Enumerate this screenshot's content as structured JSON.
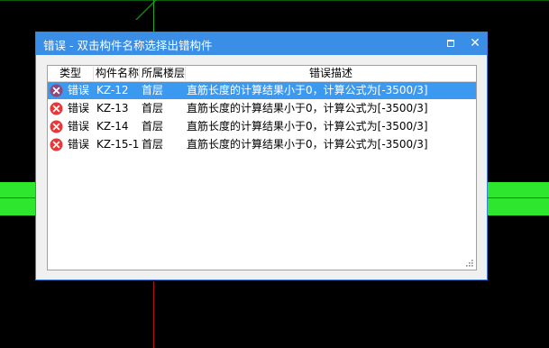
{
  "dialog": {
    "title": "错误 - 双击构件名称选择出错构件",
    "maximize_icon": "maximize-icon",
    "close_icon": "close-icon",
    "close_glyph": "✕"
  },
  "list": {
    "columns": [
      "类型",
      "构件名称",
      "所属楼层",
      "错误描述"
    ],
    "rows": [
      {
        "icon": "error-icon",
        "type": "错误",
        "name": "KZ-12",
        "floor": "首层",
        "desc": "直筋长度的计算结果小于0，计算公式为[-3500/3]",
        "selected": true
      },
      {
        "icon": "error-icon",
        "type": "错误",
        "name": "KZ-13",
        "floor": "首层",
        "desc": "直筋长度的计算结果小于0，计算公式为[-3500/3]",
        "selected": false
      },
      {
        "icon": "error-icon",
        "type": "错误",
        "name": "KZ-14",
        "floor": "首层",
        "desc": "直筋长度的计算结果小于0，计算公式为[-3500/3]",
        "selected": false
      },
      {
        "icon": "error-icon",
        "type": "错误",
        "name": "KZ-15-1",
        "floor": "首层",
        "desc": "直筋长度的计算结果小于0，计算公式为[-3500/3]",
        "selected": false
      }
    ]
  },
  "colors": {
    "titlebar": "#3a8ee6",
    "selection": "#3c99f0",
    "error_icon": "#e23a3a",
    "error_icon_selected": "#8a4a7a",
    "canvas_band": "#2ee62e"
  }
}
